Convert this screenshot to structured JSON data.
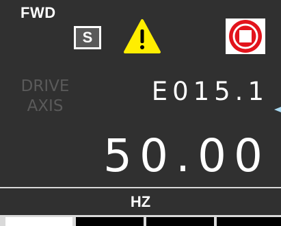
{
  "status": {
    "direction": "FWD"
  },
  "icons": {
    "sequence_letter": "S",
    "warning_icon": "warning-triangle",
    "stop_icon": "stop-octagon"
  },
  "drive": {
    "label_line1": "DRIVE",
    "label_line2": "AXIS"
  },
  "display": {
    "fault_code": "E015.1",
    "value": "50.00",
    "unit": "HZ"
  },
  "softkeys": [
    {
      "label": "",
      "active": true
    },
    {
      "label": "",
      "active": false
    },
    {
      "label": "",
      "active": false
    },
    {
      "label": "",
      "active": false
    }
  ],
  "colors": {
    "background": "#303030",
    "warning": "#ffee00",
    "stop": "#e2141c",
    "pointer": "#a8d8f0"
  }
}
